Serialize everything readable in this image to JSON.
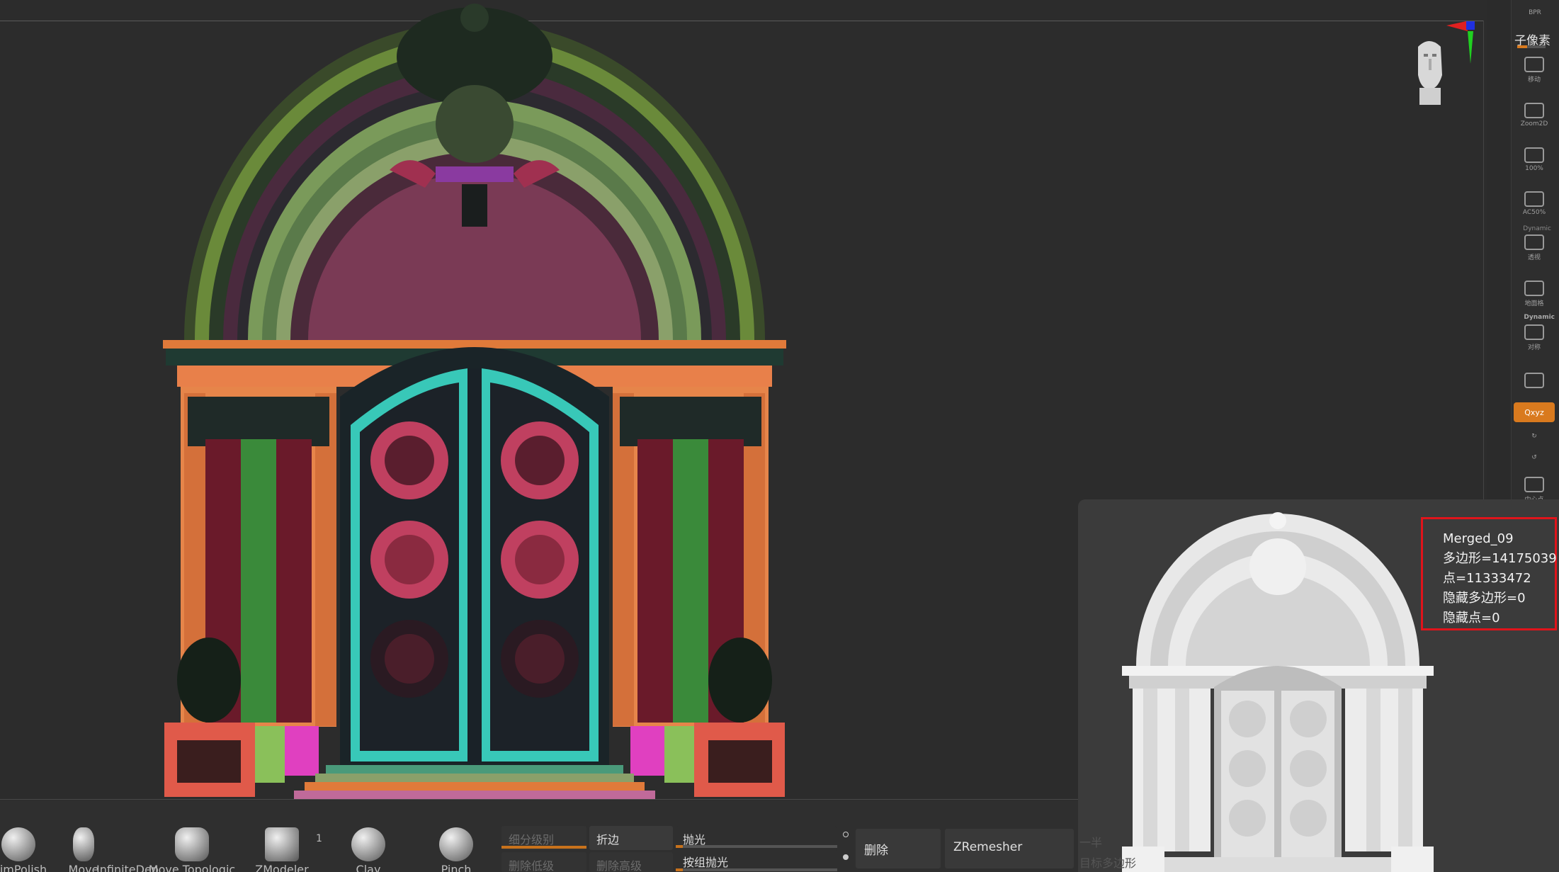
{
  "info": {
    "name": "Merged_09",
    "polygons": "多边形=14175039",
    "points": "点=11333472",
    "hidden_polys": "隐藏多边形=0",
    "hidden_points": "隐藏点=0"
  },
  "right_shelf": {
    "bpr": "BPR",
    "subpixel": "子像素",
    "move": "移动",
    "zoom2d": "Zoom2D",
    "zoom100": "100%",
    "ac50": "AC50%",
    "dynamic1": "Dynamic",
    "perspective": "透视",
    "floor": "地面格",
    "dynamic2": "Dynamic",
    "symmetry": "对称",
    "lock": "",
    "xyz": "Qxyz",
    "center": "中心点"
  },
  "brushes": [
    {
      "label": "TrimPolish"
    },
    {
      "label": "Move"
    },
    {
      "label": "InfiniteDep"
    },
    {
      "label": "Move Topologic"
    },
    {
      "label": "ZModeler"
    },
    {
      "label": "Clay"
    },
    {
      "label": "Pinch"
    }
  ],
  "brush_count": "1",
  "controls": {
    "subdiv": "细分级别",
    "fold": "折边",
    "polish": "抛光",
    "del_lower": "删除低级",
    "del_higher": "删除高级",
    "group_polish": "按组抛光",
    "delete": "删除",
    "zremesher": "ZRemesher",
    "half": "一半",
    "target_poly": "目标多边形"
  },
  "colors": {
    "accent": "#d97a1e",
    "highlight_box": "#e0141b"
  }
}
